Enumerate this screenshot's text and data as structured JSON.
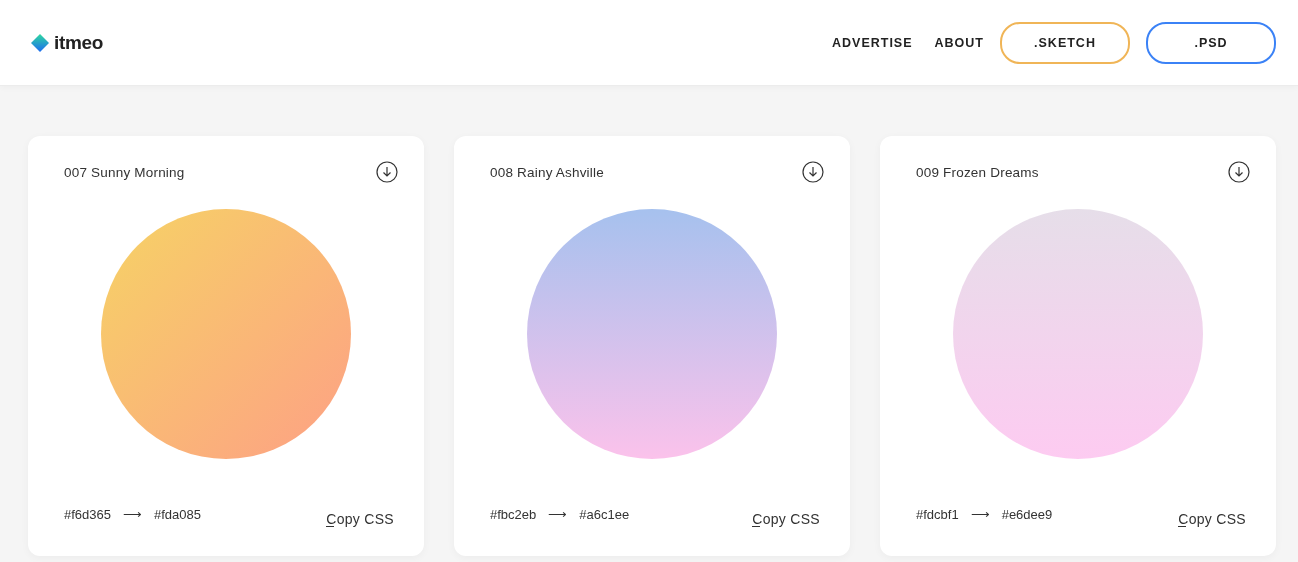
{
  "header": {
    "logo": "itmeo",
    "nav": [
      {
        "label": "ADVERTISE",
        "kind": "link"
      },
      {
        "label": "ABOUT",
        "kind": "link"
      },
      {
        "label": ".SKETCH",
        "kind": "outline",
        "color": "#f0b557"
      },
      {
        "label": ".PSD",
        "kind": "outline",
        "color": "#3b82f6"
      }
    ]
  },
  "cards": [
    {
      "title": "007 Sunny Morning",
      "kind": "diagonal",
      "stops": [
        {
          "color": "#f6d365"
        },
        {
          "color": "#fda085"
        }
      ],
      "from": "#f6d365",
      "arrow": "⟶",
      "to": "#fda085",
      "copy": "Copy CSS"
    },
    {
      "title": "008 Rainy Ashville",
      "kind": "vertical",
      "stops": [
        {
          "color": "#fbc2eb"
        },
        {
          "color": "#a6c1ee"
        }
      ],
      "from": "#fbc2eb",
      "arrow": "⟶",
      "to": "#a6c1ee",
      "copy": "Copy CSS"
    },
    {
      "title": "009 Frozen Dreams",
      "kind": "vertical",
      "stops": [
        {
          "color": "#fdcbf1"
        },
        {
          "color": "#e6dee9"
        }
      ],
      "from": "#fdcbf1",
      "arrow": "⟶",
      "to": "#e6dee9",
      "copy": "Copy CSS"
    }
  ]
}
